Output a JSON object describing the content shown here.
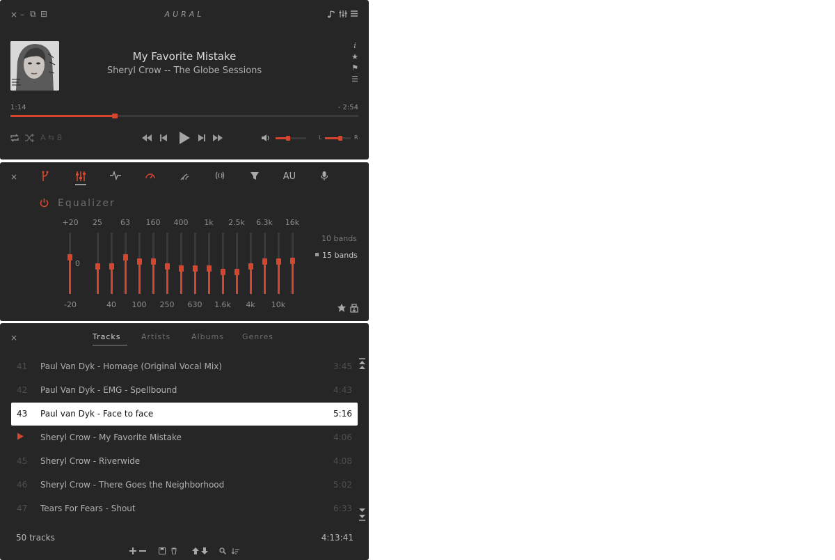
{
  "app": {
    "logo": "AURAL"
  },
  "window_controls": {
    "close": "×",
    "minimize": "–",
    "icon_a": "⧉",
    "icon_b": "⊟"
  },
  "player": {
    "track_title": "My Favorite Mistake",
    "artist_album": "Sheryl Crow -- The Globe Sessions",
    "elapsed": "1:14",
    "remaining": "- 2:54",
    "progress_fraction": 0.3,
    "volume_fraction": 0.4,
    "pan_fraction": 0.6,
    "balance_left": "L",
    "balance_right": "R",
    "ab_loop": "A ⇆ B",
    "icons": [
      "info-icon",
      "star-icon",
      "bookmark-icon",
      "chapters-icon",
      "repeat-icon",
      "shuffle-icon",
      "seek-back-icon",
      "previous-icon",
      "play-icon",
      "next-icon",
      "seek-forward-icon",
      "volume-icon",
      "playlist-toggle-icon",
      "effects-toggle-icon",
      "menu-icon"
    ]
  },
  "effects": {
    "tab_au": "AU",
    "title": "Equalizer",
    "gain_top": "+20",
    "gain_zero": "0",
    "gain_bottom": "-20",
    "top_labels": [
      "25",
      "63",
      "160",
      "400",
      "1k",
      "2.5k",
      "6.3k",
      "16k"
    ],
    "bottom_labels": [
      "40",
      "100",
      "250",
      "630",
      "1.6k",
      "4k",
      "10k"
    ],
    "preamp": 0.6,
    "bands": [
      0.45,
      0.45,
      0.6,
      0.53,
      0.53,
      0.45,
      0.42,
      0.42,
      0.42,
      0.36,
      0.36,
      0.45,
      0.53,
      0.53,
      0.55
    ],
    "band_option_10": "10 bands",
    "band_option_15": "15 bands",
    "selected_bands": "15 bands"
  },
  "playlist": {
    "tabs": [
      "Tracks",
      "Artists",
      "Albums",
      "Genres"
    ],
    "active_tab": "Tracks",
    "tracks": [
      {
        "num": "41",
        "name": "Paul Van Dyk - Homage (Original Vocal Mix)",
        "duration": "3:45"
      },
      {
        "num": "42",
        "name": "Paul Van Dyk - EMG - Spellbound",
        "duration": "4:43"
      },
      {
        "num": "43",
        "name": "Paul van Dyk - Face to face",
        "duration": "5:16"
      },
      {
        "num": "",
        "name": "Sheryl Crow - My Favorite Mistake",
        "duration": "4:06"
      },
      {
        "num": "45",
        "name": "Sheryl Crow - Riverwide",
        "duration": "4:08"
      },
      {
        "num": "46",
        "name": "Sheryl Crow - There Goes the Neighborhood",
        "duration": "5:02"
      },
      {
        "num": "47",
        "name": "Tears For Fears - Shout",
        "duration": "6:33"
      }
    ],
    "selected_index": 2,
    "playing_index": 3,
    "track_count": "50 tracks",
    "total_duration": "4:13:41"
  },
  "colors": {
    "accent": "#d6462f",
    "panel": "#262626",
    "selected_row": "#ffffff"
  }
}
